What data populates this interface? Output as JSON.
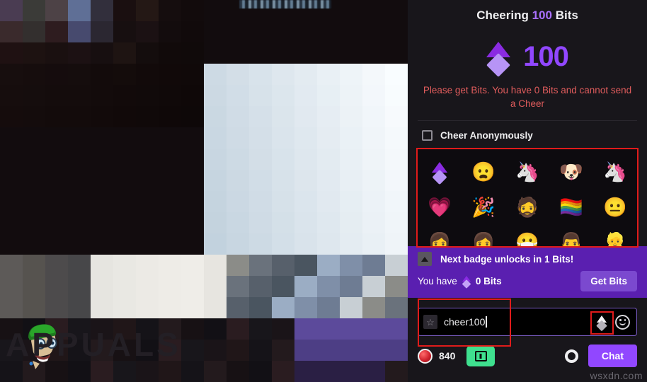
{
  "cheer_modal": {
    "header_prefix": "Cheering ",
    "header_amount": "100",
    "header_suffix": " Bits",
    "hero_amount": "100",
    "hero_gem_icon": "bits-gem-icon",
    "warning": "Please get Bits. You have 0 Bits and cannot send a Cheer",
    "anonymous_label": "Cheer Anonymously",
    "anonymous_checked": false,
    "accent_purple": "#9147ff",
    "warning_red": "#e05c5c",
    "annotation_red": "#e01b1b"
  },
  "emote_picker": {
    "rows": [
      [
        {
          "name": "bits-gem-emote",
          "glyph": ""
        },
        {
          "name": "sad-pink-face-emote",
          "glyph": "😦"
        },
        {
          "name": "unicorn-blob-emote",
          "glyph": "🦄"
        },
        {
          "name": "corgi-dog-emote",
          "glyph": "🐶"
        },
        {
          "name": "unicorn-heart-emote",
          "glyph": "🦄"
        }
      ],
      [
        {
          "name": "heart-face-emote",
          "glyph": "💗"
        },
        {
          "name": "party-popper-emote",
          "glyph": "🎉"
        },
        {
          "name": "streamer-face-emote",
          "glyph": "🧔"
        },
        {
          "name": "rainbow-flag-emote",
          "glyph": "🏳️‍🌈"
        },
        {
          "name": "grayscale-face-emote",
          "glyph": "😐"
        }
      ],
      [
        {
          "name": "clipped-emote-1",
          "glyph": "👩"
        },
        {
          "name": "clipped-emote-2",
          "glyph": "👩"
        },
        {
          "name": "clipped-emote-3",
          "glyph": "😷"
        },
        {
          "name": "clipped-emote-4",
          "glyph": "👨"
        },
        {
          "name": "clipped-emote-5",
          "glyph": "👱"
        }
      ]
    ]
  },
  "bits_banner": {
    "badge_icon": "up-arrow-badge-icon",
    "next_badge_text": "Next badge unlocks in 1 Bits!",
    "you_have_label": "You have",
    "balance": "0 Bits",
    "get_bits_label": "Get Bits",
    "banner_color": "#5a1fb0"
  },
  "chat_input": {
    "badge_icon": "star-badge-icon",
    "value": "cheer100",
    "bits_button_icon": "bits-diamond-icon",
    "emoji_button_icon": "smiley-face-icon"
  },
  "chat_bottom": {
    "points_icon": "channel-points-icon",
    "points": "840",
    "gift_icon": "gift-box-icon",
    "gear_icon": "settings-gear-icon",
    "chat_label": "Chat"
  },
  "stream": {
    "watermark": "APPUALS",
    "site_watermark": "wsxdn.com"
  }
}
